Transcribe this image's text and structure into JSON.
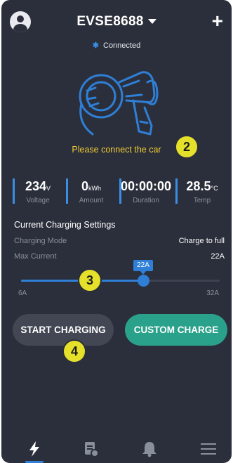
{
  "header": {
    "device_name": "EVSE8688",
    "add_label": "+"
  },
  "connection": {
    "icon": "bluetooth-icon",
    "status": "Connected"
  },
  "hero": {
    "icon": "charger-plug-icon",
    "message": "Please connect the car"
  },
  "stats": [
    {
      "value": "234",
      "unit": "V",
      "label": "Voltage"
    },
    {
      "value": "0",
      "unit": "kWh",
      "label": "Amount"
    },
    {
      "value": "00:00:00",
      "unit": "",
      "label": "Duration"
    },
    {
      "value": "28.5",
      "unit": "°C",
      "label": "Temp"
    }
  ],
  "settings": {
    "title": "Current Charging Settings",
    "mode_label": "Charging Mode",
    "mode_value": "Charge to full",
    "max_label": "Max Current",
    "max_value": "22A",
    "slider": {
      "min": 6,
      "max": 32,
      "value": 22,
      "tooltip": "22A",
      "min_label": "6A",
      "max_label": "32A"
    }
  },
  "buttons": {
    "start": "START CHARGING",
    "custom": "CUSTOM CHARGE"
  },
  "badges": {
    "b2": "2",
    "b3": "3",
    "b4": "4"
  },
  "nav": {
    "items": [
      "charge-bolt-icon",
      "records-icon",
      "notifications-bell-icon",
      "menu-icon"
    ],
    "active": 0
  },
  "colors": {
    "background": "#2b2f3b",
    "accent": "#2f7fd6",
    "warning": "#f1cd33",
    "custom_button": "#2aa18a",
    "badge": "#e5e02a"
  }
}
